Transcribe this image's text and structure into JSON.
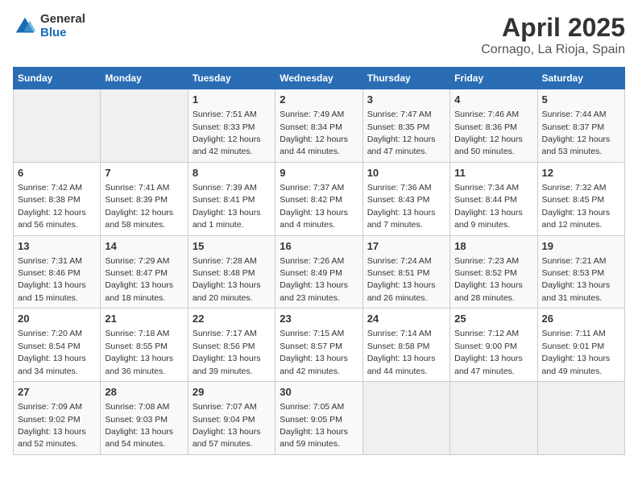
{
  "header": {
    "logo_general": "General",
    "logo_blue": "Blue",
    "title": "April 2025",
    "subtitle": "Cornago, La Rioja, Spain"
  },
  "weekdays": [
    "Sunday",
    "Monday",
    "Tuesday",
    "Wednesday",
    "Thursday",
    "Friday",
    "Saturday"
  ],
  "weeks": [
    [
      {
        "day": null
      },
      {
        "day": null
      },
      {
        "day": "1",
        "sunrise": "Sunrise: 7:51 AM",
        "sunset": "Sunset: 8:33 PM",
        "daylight": "Daylight: 12 hours and 42 minutes."
      },
      {
        "day": "2",
        "sunrise": "Sunrise: 7:49 AM",
        "sunset": "Sunset: 8:34 PM",
        "daylight": "Daylight: 12 hours and 44 minutes."
      },
      {
        "day": "3",
        "sunrise": "Sunrise: 7:47 AM",
        "sunset": "Sunset: 8:35 PM",
        "daylight": "Daylight: 12 hours and 47 minutes."
      },
      {
        "day": "4",
        "sunrise": "Sunrise: 7:46 AM",
        "sunset": "Sunset: 8:36 PM",
        "daylight": "Daylight: 12 hours and 50 minutes."
      },
      {
        "day": "5",
        "sunrise": "Sunrise: 7:44 AM",
        "sunset": "Sunset: 8:37 PM",
        "daylight": "Daylight: 12 hours and 53 minutes."
      }
    ],
    [
      {
        "day": "6",
        "sunrise": "Sunrise: 7:42 AM",
        "sunset": "Sunset: 8:38 PM",
        "daylight": "Daylight: 12 hours and 56 minutes."
      },
      {
        "day": "7",
        "sunrise": "Sunrise: 7:41 AM",
        "sunset": "Sunset: 8:39 PM",
        "daylight": "Daylight: 12 hours and 58 minutes."
      },
      {
        "day": "8",
        "sunrise": "Sunrise: 7:39 AM",
        "sunset": "Sunset: 8:41 PM",
        "daylight": "Daylight: 13 hours and 1 minute."
      },
      {
        "day": "9",
        "sunrise": "Sunrise: 7:37 AM",
        "sunset": "Sunset: 8:42 PM",
        "daylight": "Daylight: 13 hours and 4 minutes."
      },
      {
        "day": "10",
        "sunrise": "Sunrise: 7:36 AM",
        "sunset": "Sunset: 8:43 PM",
        "daylight": "Daylight: 13 hours and 7 minutes."
      },
      {
        "day": "11",
        "sunrise": "Sunrise: 7:34 AM",
        "sunset": "Sunset: 8:44 PM",
        "daylight": "Daylight: 13 hours and 9 minutes."
      },
      {
        "day": "12",
        "sunrise": "Sunrise: 7:32 AM",
        "sunset": "Sunset: 8:45 PM",
        "daylight": "Daylight: 13 hours and 12 minutes."
      }
    ],
    [
      {
        "day": "13",
        "sunrise": "Sunrise: 7:31 AM",
        "sunset": "Sunset: 8:46 PM",
        "daylight": "Daylight: 13 hours and 15 minutes."
      },
      {
        "day": "14",
        "sunrise": "Sunrise: 7:29 AM",
        "sunset": "Sunset: 8:47 PM",
        "daylight": "Daylight: 13 hours and 18 minutes."
      },
      {
        "day": "15",
        "sunrise": "Sunrise: 7:28 AM",
        "sunset": "Sunset: 8:48 PM",
        "daylight": "Daylight: 13 hours and 20 minutes."
      },
      {
        "day": "16",
        "sunrise": "Sunrise: 7:26 AM",
        "sunset": "Sunset: 8:49 PM",
        "daylight": "Daylight: 13 hours and 23 minutes."
      },
      {
        "day": "17",
        "sunrise": "Sunrise: 7:24 AM",
        "sunset": "Sunset: 8:51 PM",
        "daylight": "Daylight: 13 hours and 26 minutes."
      },
      {
        "day": "18",
        "sunrise": "Sunrise: 7:23 AM",
        "sunset": "Sunset: 8:52 PM",
        "daylight": "Daylight: 13 hours and 28 minutes."
      },
      {
        "day": "19",
        "sunrise": "Sunrise: 7:21 AM",
        "sunset": "Sunset: 8:53 PM",
        "daylight": "Daylight: 13 hours and 31 minutes."
      }
    ],
    [
      {
        "day": "20",
        "sunrise": "Sunrise: 7:20 AM",
        "sunset": "Sunset: 8:54 PM",
        "daylight": "Daylight: 13 hours and 34 minutes."
      },
      {
        "day": "21",
        "sunrise": "Sunrise: 7:18 AM",
        "sunset": "Sunset: 8:55 PM",
        "daylight": "Daylight: 13 hours and 36 minutes."
      },
      {
        "day": "22",
        "sunrise": "Sunrise: 7:17 AM",
        "sunset": "Sunset: 8:56 PM",
        "daylight": "Daylight: 13 hours and 39 minutes."
      },
      {
        "day": "23",
        "sunrise": "Sunrise: 7:15 AM",
        "sunset": "Sunset: 8:57 PM",
        "daylight": "Daylight: 13 hours and 42 minutes."
      },
      {
        "day": "24",
        "sunrise": "Sunrise: 7:14 AM",
        "sunset": "Sunset: 8:58 PM",
        "daylight": "Daylight: 13 hours and 44 minutes."
      },
      {
        "day": "25",
        "sunrise": "Sunrise: 7:12 AM",
        "sunset": "Sunset: 9:00 PM",
        "daylight": "Daylight: 13 hours and 47 minutes."
      },
      {
        "day": "26",
        "sunrise": "Sunrise: 7:11 AM",
        "sunset": "Sunset: 9:01 PM",
        "daylight": "Daylight: 13 hours and 49 minutes."
      }
    ],
    [
      {
        "day": "27",
        "sunrise": "Sunrise: 7:09 AM",
        "sunset": "Sunset: 9:02 PM",
        "daylight": "Daylight: 13 hours and 52 minutes."
      },
      {
        "day": "28",
        "sunrise": "Sunrise: 7:08 AM",
        "sunset": "Sunset: 9:03 PM",
        "daylight": "Daylight: 13 hours and 54 minutes."
      },
      {
        "day": "29",
        "sunrise": "Sunrise: 7:07 AM",
        "sunset": "Sunset: 9:04 PM",
        "daylight": "Daylight: 13 hours and 57 minutes."
      },
      {
        "day": "30",
        "sunrise": "Sunrise: 7:05 AM",
        "sunset": "Sunset: 9:05 PM",
        "daylight": "Daylight: 13 hours and 59 minutes."
      },
      {
        "day": null
      },
      {
        "day": null
      },
      {
        "day": null
      }
    ]
  ]
}
